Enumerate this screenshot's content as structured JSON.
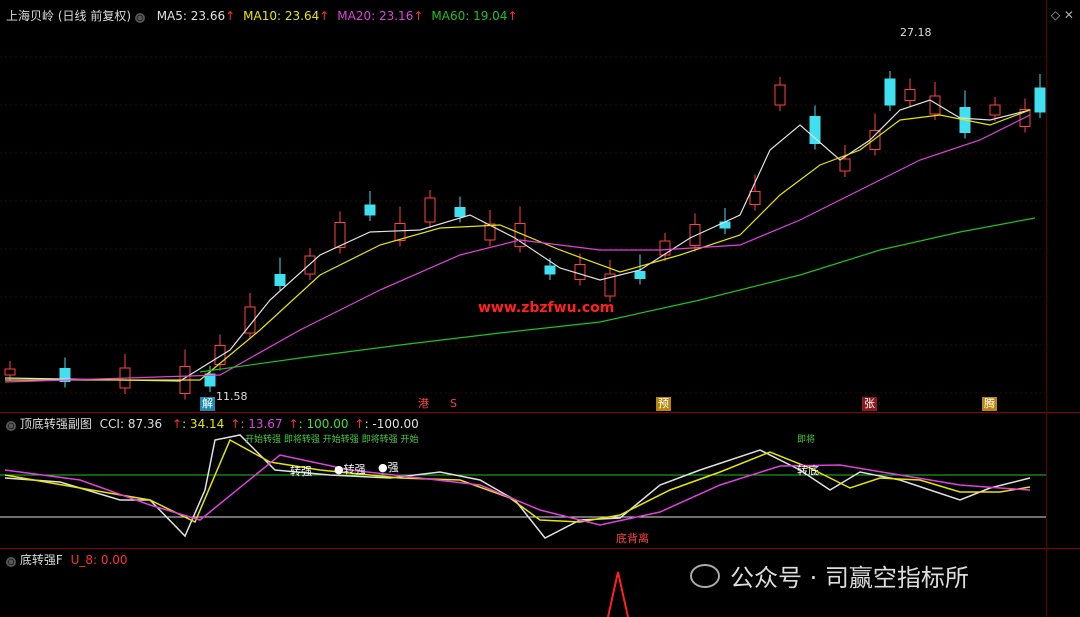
{
  "main_panel": {
    "stock_name": "上海贝岭",
    "period_label": "(日线 前复权)",
    "ma": [
      {
        "label": "MA5: 23.66",
        "color": "#e0e0e0"
      },
      {
        "label": "MA10: 23.64",
        "color": "#e6e600"
      },
      {
        "label": "MA20: 23.16",
        "color": "#e040e0"
      },
      {
        "label": "MA60: 19.04",
        "color": "#20c020"
      }
    ],
    "high_label": "27.18",
    "low_label": "11.58",
    "watermark_site": "www.zbzfwu.com",
    "event_tags": [
      {
        "text": "解",
        "bg": "#1a8ab0",
        "color": "#fff"
      },
      {
        "text": "港",
        "bg": "#000",
        "color": "#ff4040"
      },
      {
        "text": "S",
        "bg": "#000",
        "color": "#ff4040"
      },
      {
        "text": "预",
        "bg": "#b8860b",
        "color": "#fff"
      },
      {
        "text": "张",
        "bg": "#8b1a1a",
        "color": "#fff"
      },
      {
        "text": "腾",
        "bg": "#b8860b",
        "color": "#fff"
      }
    ]
  },
  "cci_panel": {
    "title": "顶底转强副图",
    "cci_label": "CCI: 87.36",
    "values": [
      {
        "text": ": 34.14",
        "color": "#e6e600"
      },
      {
        "text": ": 13.67",
        "color": "#e040e0"
      },
      {
        "text": ": 100.00",
        "color": "#40e040"
      },
      {
        "text": ": -100.00",
        "color": "#e0e0e0"
      }
    ],
    "annot_top_left": "开始转强 即将转强 开始转强 即将转强 开始",
    "annot_top_right": "即将",
    "annot_mid": [
      "转强",
      "●转强",
      "●强"
    ],
    "annot_turn": "转底",
    "annot_bottom": "底背离"
  },
  "bottom_panel": {
    "title": "底转强F",
    "value": "U_8: 0.00"
  },
  "wechat_watermark": "公众号 · 司赢空指标所"
}
